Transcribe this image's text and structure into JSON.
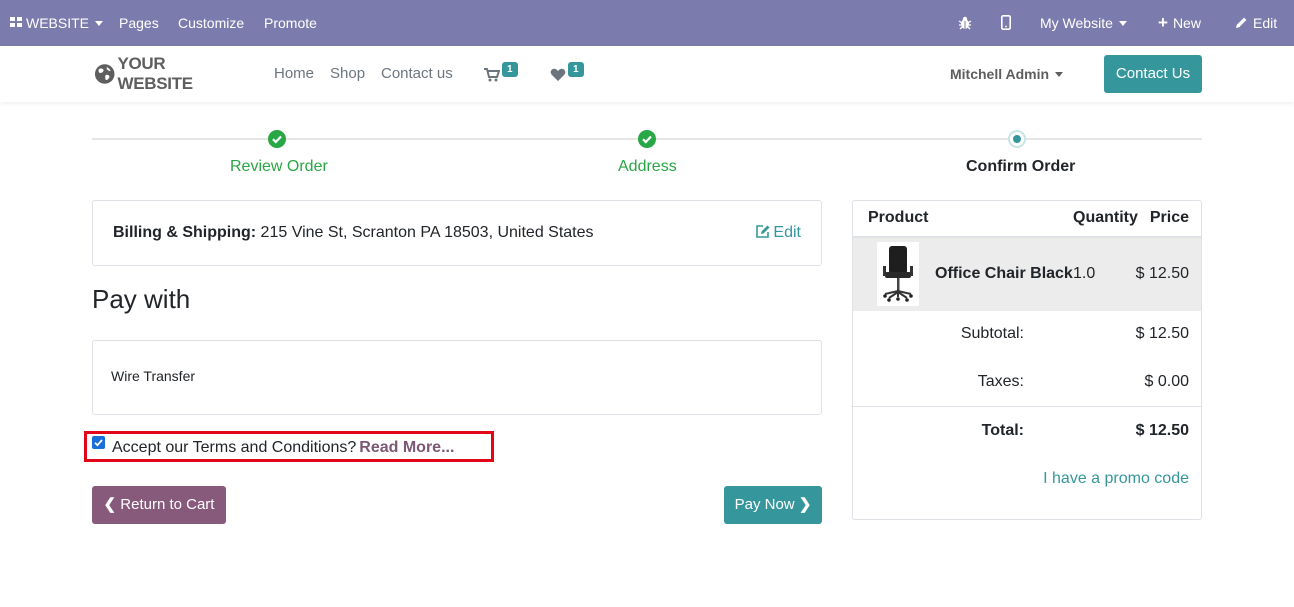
{
  "adminbar": {
    "website_label": "WEBSITE",
    "pages_label": "Pages",
    "customize_label": "Customize",
    "promote_label": "Promote",
    "my_website_label": "My Website",
    "new_label": "New",
    "edit_label": "Edit",
    "bg_color": "#7c7bad"
  },
  "navbar": {
    "logo_text": "YOUR WEBSITE",
    "links": [
      "Home",
      "Shop",
      "Contact us"
    ],
    "cart_count": "1",
    "wishlist_count": "1",
    "user_name": "Mitchell Admin",
    "contact_button": "Contact Us"
  },
  "wizard": {
    "steps": [
      {
        "label": "Review Order",
        "state": "done"
      },
      {
        "label": "Address",
        "state": "done"
      },
      {
        "label": "Confirm Order",
        "state": "current"
      }
    ],
    "done_color": "#28a745",
    "current_color": "#35979c"
  },
  "billing": {
    "label": "Billing & Shipping:",
    "address": "215 Vine St, Scranton PA 18503, United States",
    "edit_label": "Edit"
  },
  "payment": {
    "title": "Pay with",
    "method": "Wire Transfer",
    "terms_text": "Accept our Terms and Conditions?",
    "terms_link": "Read More...",
    "terms_checked": true,
    "return_label": "Return to Cart",
    "pay_label": "Pay Now"
  },
  "summary": {
    "headers": {
      "product": "Product",
      "quantity": "Quantity",
      "price": "Price"
    },
    "item": {
      "name": "Office Chair Black",
      "quantity": "1.0",
      "price": "$ 12.50"
    },
    "subtotal_label": "Subtotal:",
    "subtotal": "$ 12.50",
    "taxes_label": "Taxes:",
    "taxes": "$ 0.00",
    "total_label": "Total:",
    "total": "$ 12.50",
    "promo_label": "I have a promo code"
  }
}
